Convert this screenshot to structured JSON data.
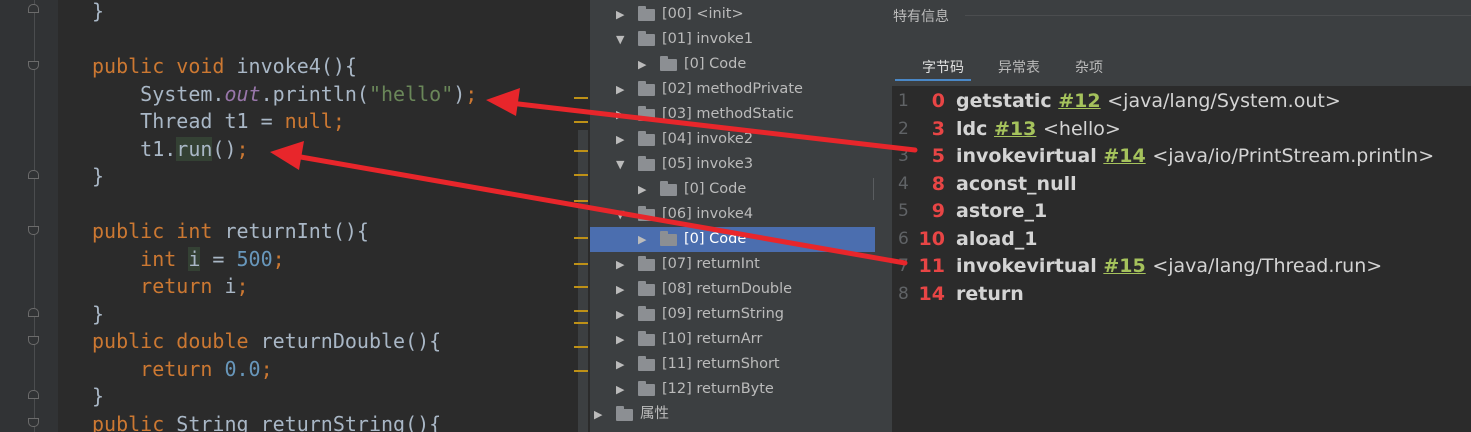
{
  "editor": {
    "lines": [
      {
        "segments": [
          {
            "t": "}",
            "c": "m"
          }
        ]
      },
      {
        "segments": []
      },
      {
        "segments": [
          {
            "t": "public ",
            "c": "kw"
          },
          {
            "t": "void ",
            "c": "kw"
          },
          {
            "t": "invoke4",
            "c": "fn"
          },
          {
            "t": "(){",
            "c": "m"
          }
        ]
      },
      {
        "segments": [
          {
            "t": "    System.",
            "c": "m"
          },
          {
            "t": "out",
            "c": "it"
          },
          {
            "t": ".println(",
            "c": "m"
          },
          {
            "t": "\"hello\"",
            "c": "st"
          },
          {
            "t": ")",
            "c": "m"
          },
          {
            "t": ";",
            "c": "kw"
          }
        ]
      },
      {
        "segments": [
          {
            "t": "    Thread t1 = ",
            "c": "m"
          },
          {
            "t": "null",
            "c": "kw"
          },
          {
            "t": ";",
            "c": "kw"
          }
        ]
      },
      {
        "segments": [
          {
            "t": "    t1.",
            "c": "m"
          },
          {
            "t": "run",
            "c": "hl"
          },
          {
            "t": "()",
            "c": "m"
          },
          {
            "t": ";",
            "c": "kw"
          }
        ]
      },
      {
        "segments": [
          {
            "t": "}",
            "c": "m"
          }
        ]
      },
      {
        "segments": []
      },
      {
        "segments": [
          {
            "t": "public ",
            "c": "kw"
          },
          {
            "t": "int ",
            "c": "kw"
          },
          {
            "t": "returnInt",
            "c": "fn"
          },
          {
            "t": "(){",
            "c": "m"
          }
        ]
      },
      {
        "segments": [
          {
            "t": "    ",
            "c": "m"
          },
          {
            "t": "int ",
            "c": "kw"
          },
          {
            "t": "i",
            "c": "hl"
          },
          {
            "t": " = ",
            "c": "m"
          },
          {
            "t": "500",
            "c": "nu"
          },
          {
            "t": ";",
            "c": "kw"
          }
        ]
      },
      {
        "segments": [
          {
            "t": "    ",
            "c": "m"
          },
          {
            "t": "return ",
            "c": "kw"
          },
          {
            "t": "i",
            "c": "m"
          },
          {
            "t": ";",
            "c": "kw"
          }
        ]
      },
      {
        "segments": [
          {
            "t": "}",
            "c": "m"
          }
        ]
      },
      {
        "segments": [
          {
            "t": "public ",
            "c": "kw"
          },
          {
            "t": "double ",
            "c": "kw"
          },
          {
            "t": "returnDouble",
            "c": "fn"
          },
          {
            "t": "(){",
            "c": "m"
          }
        ]
      },
      {
        "segments": [
          {
            "t": "    ",
            "c": "m"
          },
          {
            "t": "return ",
            "c": "kw"
          },
          {
            "t": "0.0",
            "c": "nu"
          },
          {
            "t": ";",
            "c": "kw"
          }
        ]
      },
      {
        "segments": [
          {
            "t": "}",
            "c": "m"
          }
        ]
      },
      {
        "segments": [
          {
            "t": "public ",
            "c": "kw"
          },
          {
            "t": "String ",
            "c": "m"
          },
          {
            "t": "returnString",
            "c": "fn"
          },
          {
            "t": "(){",
            "c": "m"
          }
        ]
      }
    ]
  },
  "tree": {
    "items": [
      {
        "label": "[00] <init>",
        "indent": 0,
        "expanded": false,
        "selected": false
      },
      {
        "label": "[01] invoke1",
        "indent": 0,
        "expanded": true,
        "selected": false
      },
      {
        "label": "[0] Code",
        "indent": 1,
        "expanded": false,
        "selected": false
      },
      {
        "label": "[02] methodPrivate",
        "indent": 0,
        "expanded": false,
        "selected": false
      },
      {
        "label": "[03] methodStatic",
        "indent": 0,
        "expanded": false,
        "selected": false
      },
      {
        "label": "[04] invoke2",
        "indent": 0,
        "expanded": false,
        "selected": false
      },
      {
        "label": "[05] invoke3",
        "indent": 0,
        "expanded": true,
        "selected": false
      },
      {
        "label": "[0] Code",
        "indent": 1,
        "expanded": false,
        "selected": false
      },
      {
        "label": "[06] invoke4",
        "indent": 0,
        "expanded": true,
        "selected": false
      },
      {
        "label": "[0] Code",
        "indent": 1,
        "expanded": false,
        "selected": true
      },
      {
        "label": "[07] returnInt",
        "indent": 0,
        "expanded": false,
        "selected": false
      },
      {
        "label": "[08] returnDouble",
        "indent": 0,
        "expanded": false,
        "selected": false
      },
      {
        "label": "[09] returnString",
        "indent": 0,
        "expanded": false,
        "selected": false
      },
      {
        "label": "[10] returnArr",
        "indent": 0,
        "expanded": false,
        "selected": false
      },
      {
        "label": "[11] returnShort",
        "indent": 0,
        "expanded": false,
        "selected": false
      },
      {
        "label": "[12] returnByte",
        "indent": 0,
        "expanded": false,
        "selected": false
      },
      {
        "label": "属性",
        "indent": -1,
        "expanded": false,
        "selected": false
      }
    ]
  },
  "info": {
    "title": "特有信息",
    "tabs": [
      "字节码",
      "异常表",
      "杂项"
    ],
    "active_tab": 0,
    "bytecode": [
      {
        "line": "1",
        "offset": "0",
        "op": "getstatic",
        "ref": "#12",
        "arg": "<java/lang/System.out>"
      },
      {
        "line": "2",
        "offset": "3",
        "op": "ldc",
        "ref": "#13",
        "arg": "<hello>"
      },
      {
        "line": "3",
        "offset": "5",
        "op": "invokevirtual",
        "ref": "#14",
        "arg": "<java/io/PrintStream.println>"
      },
      {
        "line": "4",
        "offset": "8",
        "op": "aconst_null",
        "ref": "",
        "arg": ""
      },
      {
        "line": "5",
        "offset": "9",
        "op": "astore_1",
        "ref": "",
        "arg": ""
      },
      {
        "line": "6",
        "offset": "10",
        "op": "aload_1",
        "ref": "",
        "arg": ""
      },
      {
        "line": "7",
        "offset": "11",
        "op": "invokevirtual",
        "ref": "#15",
        "arg": "<java/lang/Thread.run>"
      },
      {
        "line": "8",
        "offset": "14",
        "op": "return",
        "ref": "",
        "arg": ""
      }
    ]
  },
  "colors": {
    "arrow": "#e8262b",
    "selection": "#4b6eaf",
    "keyword": "#cc7832",
    "string": "#6a8759",
    "number": "#6897bb",
    "offset": "#e84545",
    "ref": "#a5c25c"
  }
}
